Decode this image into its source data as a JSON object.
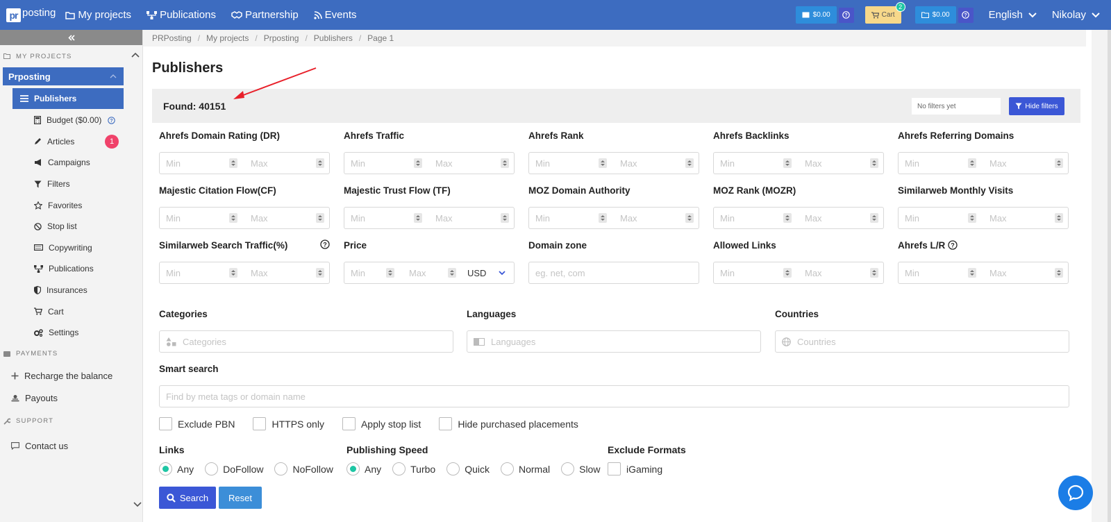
{
  "topbar": {
    "logo_mark": "pr",
    "logo_text": "posting",
    "nav": [
      {
        "label": "My projects",
        "icon": "folder-icon"
      },
      {
        "label": "Publications",
        "icon": "network-icon"
      },
      {
        "label": "Partnership",
        "icon": "handshake-icon"
      },
      {
        "label": "Events",
        "icon": "rss-icon"
      }
    ],
    "balance1": "$0.00",
    "cart_label": "Cart",
    "cart_count": "2",
    "balance2": "$0.00",
    "language": "English",
    "user": "Nikolay"
  },
  "sidebar": {
    "my_projects_heading": "MY PROJECTS",
    "project_name": "Prposting",
    "items": [
      {
        "label": "Publishers",
        "icon": "list-icon",
        "active": true
      },
      {
        "label": "Budget ($0.00)",
        "icon": "calculator-icon"
      },
      {
        "label": "Articles",
        "icon": "pencil-icon",
        "badge": "1"
      },
      {
        "label": "Campaigns",
        "icon": "megaphone-icon"
      },
      {
        "label": "Filters",
        "icon": "filter-icon"
      },
      {
        "label": "Favorites",
        "icon": "star-icon"
      },
      {
        "label": "Stop list",
        "icon": "stop-icon"
      },
      {
        "label": "Copywriting",
        "icon": "keyboard-icon"
      },
      {
        "label": "Publications",
        "icon": "network-icon"
      },
      {
        "label": "Insurances",
        "icon": "shield-icon"
      },
      {
        "label": "Cart",
        "icon": "cart-icon"
      },
      {
        "label": "Settings",
        "icon": "gears-icon"
      }
    ],
    "payments_heading": "PAYMENTS",
    "recharge_label": "Recharge the balance",
    "payouts_label": "Payouts",
    "support_heading": "SUPPORT",
    "contact_label": "Contact us"
  },
  "breadcrumb": [
    "PRPosting",
    "My projects",
    "Prposting",
    "Publishers",
    "Page 1"
  ],
  "page_title": "Publishers",
  "found": "Found: 40151",
  "no_filters": "No filters yet",
  "hide_filters": "Hide filters",
  "placeholders": {
    "min": "Min",
    "max": "Max"
  },
  "filters_row1": [
    "Ahrefs Domain Rating (DR)",
    "Ahrefs Traffic",
    "Ahrefs Rank",
    "Ahrefs Backlinks",
    "Ahrefs Referring Domains"
  ],
  "filters_row2": [
    "Majestic Citation Flow(CF)",
    "Majestic Trust Flow (TF)",
    "MOZ Domain Authority",
    "MOZ Rank (MOZR)",
    "Similarweb Monthly Visits"
  ],
  "filters_row3": {
    "similarweb_search": "Similarweb Search Traffic(%)",
    "price": "Price",
    "currency": "USD",
    "domain_zone": "Domain zone",
    "domain_zone_placeholder": "eg. net, com",
    "allowed_links": "Allowed Links",
    "ahrefs_lr": "Ahrefs L/R"
  },
  "categories_label": "Categories",
  "categories_placeholder": "Categories",
  "languages_label": "Languages",
  "languages_placeholder": "Languages",
  "countries_label": "Countries",
  "countries_placeholder": "Countries",
  "smart_search_label": "Smart search",
  "smart_search_placeholder": "Find by meta tags or domain name",
  "checkboxes": [
    "Exclude PBN",
    "HTTPS only",
    "Apply stop list",
    "Hide purchased placements"
  ],
  "links": {
    "label": "Links",
    "options": [
      "Any",
      "DoFollow",
      "NoFollow"
    ],
    "selected": "Any"
  },
  "speed": {
    "label": "Publishing Speed",
    "options": [
      "Any",
      "Turbo",
      "Quick",
      "Normal",
      "Slow"
    ],
    "selected": "Any"
  },
  "exclude_formats": {
    "label": "Exclude Formats",
    "options": [
      "iGaming"
    ]
  },
  "search_btn": "Search",
  "reset_btn": "Reset",
  "colors": {
    "primary": "#3d6cc0",
    "accent_button": "#3b57d6",
    "radio_on": "#1ec6a4",
    "badge": "#f0426a",
    "arrow": "#e8202a"
  }
}
